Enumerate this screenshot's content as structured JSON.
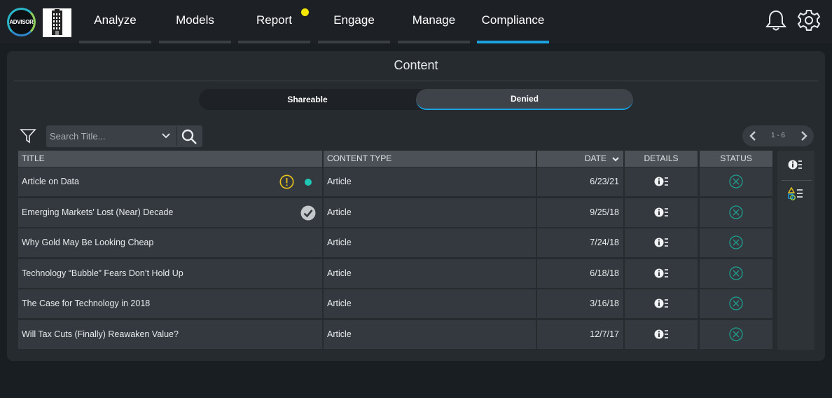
{
  "brand": {
    "logo_text": "ADVISOR"
  },
  "nav": {
    "tabs": [
      {
        "label": "Analyze",
        "active": false
      },
      {
        "label": "Models",
        "active": false
      },
      {
        "label": "Report",
        "active": false,
        "has_notification": true
      },
      {
        "label": "Engage",
        "active": false
      },
      {
        "label": "Manage",
        "active": false
      },
      {
        "label": "Compliance",
        "active": true
      }
    ],
    "icons": [
      "bell-icon",
      "gear-icon"
    ]
  },
  "panel": {
    "title": "Content",
    "segments": [
      {
        "label": "Shareable",
        "active": false
      },
      {
        "label": "Denied",
        "active": true
      }
    ]
  },
  "toolbar": {
    "search_placeholder": "Search Title...",
    "pager_range": "1 - 6"
  },
  "table": {
    "headers": {
      "title": "TITLE",
      "content_type": "CONTENT TYPE",
      "date": "DATE",
      "details": "DETAILS",
      "status": "STATUS"
    },
    "sort": {
      "column": "date",
      "direction": "descending"
    },
    "rows": [
      {
        "title": "Article on Data",
        "content_type": "Article",
        "date": "6/23/21",
        "flag": "warning",
        "dot": true,
        "status": "denied"
      },
      {
        "title": "Emerging Markets' Lost (Near) Decade",
        "content_type": "Article",
        "date": "9/25/18",
        "flag": "approved",
        "dot": false,
        "status": "denied"
      },
      {
        "title": "Why Gold May Be Looking Cheap",
        "content_type": "Article",
        "date": "7/24/18",
        "flag": "",
        "dot": false,
        "status": "denied"
      },
      {
        "title": "Technology “Bubble” Fears Don’t Hold Up",
        "content_type": "Article",
        "date": "6/18/18",
        "flag": "",
        "dot": false,
        "status": "denied"
      },
      {
        "title": "The Case for Technology in 2018",
        "content_type": "Article",
        "date": "3/16/18",
        "flag": "",
        "dot": false,
        "status": "denied"
      },
      {
        "title": "Will Tax Cuts (Finally) Reawaken Value?",
        "content_type": "Article",
        "date": "12/7/17",
        "flag": "",
        "dot": false,
        "status": "denied"
      }
    ]
  },
  "colors": {
    "accent": "#1ba3e0",
    "notification": "#f3e600",
    "warning": "#e8c21c",
    "dot": "#1fc7b5",
    "status_icon": "#1f9e8e"
  }
}
